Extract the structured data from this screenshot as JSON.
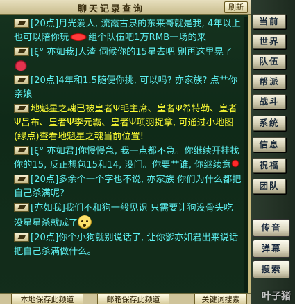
{
  "window": {
    "title": "聊天记录查询",
    "refresh_label": "刷新"
  },
  "messages": [
    {
      "color": "cyan",
      "text": "[20点]月光爱人, 流霞古泉的东来哥就是我, 4年以上也可以陪你玩",
      "emoji": "lips",
      "text2": "组个队伍吧1万RMB一场的来"
    },
    {
      "color": "cyan",
      "text": "[ξ° 亦如我]人渣 伺候你的15星去吧 别再这里晃了",
      "emoji": "crab"
    },
    {
      "color": "cyan",
      "text": "[20点]4年和1.5随便你挑, 可以吗? 亦家族? 点艹你亲娘"
    },
    {
      "color": "yellow",
      "text": "地魁星之魂已被皇者Ψ毛主席、皇者Ψ希特勒、皇者Ψ吕布、皇者Ψ李元霸、皇者Ψ项羽捉拿, 可通过小地图(绿点)查看地魁星之魂当前位置!"
    },
    {
      "color": "cyan",
      "text": "[ξ° 亦如君]你慢慢急, 我一点都不急。你继续开挂找你的15, 反正想包15和14, 没门。你要艹谁, 你继续意"
    },
    {
      "color": "cyan",
      "text": "[20点]多余个一个字也不说, 亦家族 你们为什么都把自己杀满呢?"
    },
    {
      "color": "cyan",
      "text": "[亦如我]我们不和狗一般见识 只需要让狗没骨头吃 没星星杀就成了",
      "emoji": "face"
    },
    {
      "color": "cyan",
      "text": "[20点]你个小狗就别说话了, 让你爹亦如君出来说话 把自己杀满做什么。"
    }
  ],
  "bottom": {
    "local_save": "本地保存此频道",
    "mail_save": "邮箱保存此频道",
    "keyword_search": "关键词搜索"
  },
  "side_menu": [
    "当前",
    "世界",
    "队伍",
    "帮派",
    "战斗",
    "系统",
    "信息",
    "祝福",
    "团队"
  ],
  "side_scroll": [
    "传音",
    "弹幕",
    "搜索"
  ],
  "watermark": "叶子猪"
}
